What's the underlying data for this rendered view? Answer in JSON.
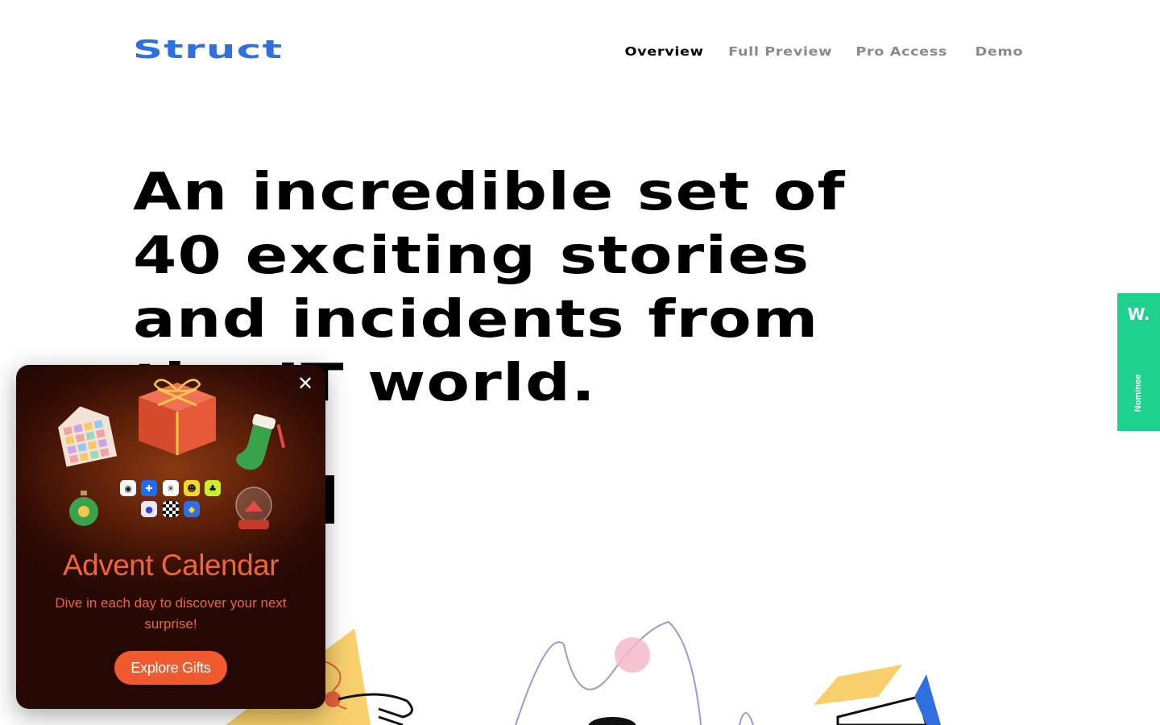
{
  "brand": {
    "logo": "Struct",
    "color": "#2f6fe0"
  },
  "nav": {
    "items": [
      {
        "label": "Overview",
        "active": true
      },
      {
        "label": "Full Preview",
        "active": false
      },
      {
        "label": "Pro Access",
        "active": false
      },
      {
        "label": "Demo",
        "active": false
      }
    ]
  },
  "hero": {
    "headline": "An incredible set of 40 exciting stories and incidents from the IT world."
  },
  "side_badge": {
    "logo": "W.",
    "label": "Nominee",
    "color": "#1fd18f"
  },
  "popup": {
    "title": "Advent Calendar",
    "description": "Dive in each day to discover your next surprise!",
    "button_label": "Explore Gifts",
    "close_icon": "close-icon",
    "accent": "#f0643a",
    "icons": [
      "eye-icon",
      "plus-icon",
      "star-icon",
      "smile-icon",
      "leaf-icon",
      "dot-icon",
      "checker-icon",
      "duck-icon"
    ]
  }
}
